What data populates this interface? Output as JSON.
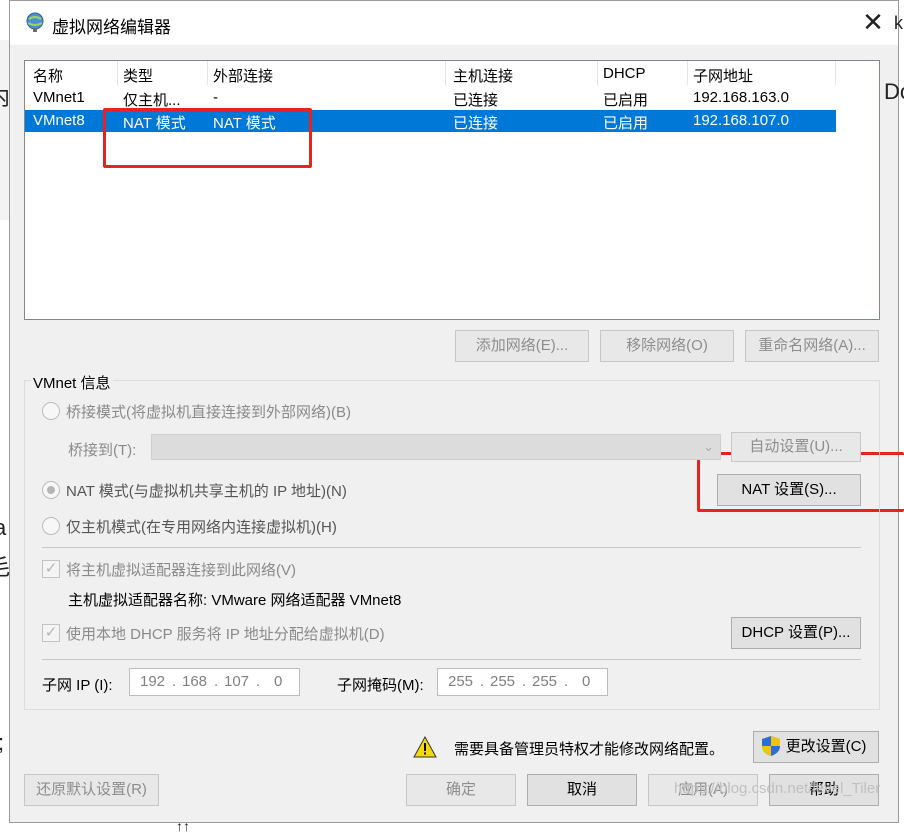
{
  "window": {
    "title": "虚拟网络编辑器",
    "close_glyph": "✕"
  },
  "background_fragments": {
    "left_top": "内",
    "right_top_1": "k",
    "right_top_2": "Do",
    "left_mid_1": "a",
    "left_mid_2": "毛",
    "left_low": ";",
    "bottom": "↑↑"
  },
  "network_table": {
    "columns": [
      "名称",
      "类型",
      "外部连接",
      "主机连接",
      "DHCP",
      "子网地址"
    ],
    "rows": [
      {
        "name": "VMnet1",
        "type": "仅主机...",
        "external": "-",
        "host": "已连接",
        "dhcp": "已启用",
        "subnet": "192.168.163.0",
        "selected": false
      },
      {
        "name": "VMnet8",
        "type": "NAT 模式",
        "external": "NAT 模式",
        "host": "已连接",
        "dhcp": "已启用",
        "subnet": "192.168.107.0",
        "selected": true
      }
    ]
  },
  "list_buttons": {
    "add": "添加网络(E)...",
    "remove": "移除网络(O)",
    "rename": "重命名网络(A)..."
  },
  "vmnet_info": {
    "group_title": "VMnet 信息",
    "bridged_label": "桥接模式(将虚拟机直接连接到外部网络)(B)",
    "bridge_to_label": "桥接到(T):",
    "bridge_to_value": "",
    "auto_settings": "自动设置(U)...",
    "nat_label": "NAT 模式(与虚拟机共享主机的 IP 地址)(N)",
    "nat_settings": "NAT 设置(S)...",
    "hostonly_label": "仅主机模式(在专用网络内连接虚拟机)(H)",
    "selected_mode": "nat",
    "connect_adapter_label": "将主机虚拟适配器连接到此网络(V)",
    "connect_adapter_checked": true,
    "adapter_name_label": "主机虚拟适配器名称: VMware 网络适配器 VMnet8",
    "use_dhcp_label": "使用本地 DHCP 服务将 IP 地址分配给虚拟机(D)",
    "use_dhcp_checked": true,
    "dhcp_settings": "DHCP 设置(P)...",
    "subnet_ip_label": "子网 IP (I):",
    "subnet_ip": [
      "192",
      "168",
      "107",
      "0"
    ],
    "subnet_mask_label": "子网掩码(M):",
    "subnet_mask": [
      "255",
      "255",
      "255",
      "0"
    ]
  },
  "warning": {
    "text": "需要具备管理员特权才能修改网络配置。",
    "change_settings": "更改设置(C)"
  },
  "footer": {
    "restore_defaults": "还原默认设置(R)",
    "ok": "确定",
    "cancel": "取消",
    "apply": "应用(A)",
    "help": "帮助"
  },
  "watermark": "https://blog.csdn.net/level_Tiler",
  "colors": {
    "selection": "#0078d7",
    "highlight_box": "#e8231f",
    "dialog_bg": "#f0f0f0"
  }
}
